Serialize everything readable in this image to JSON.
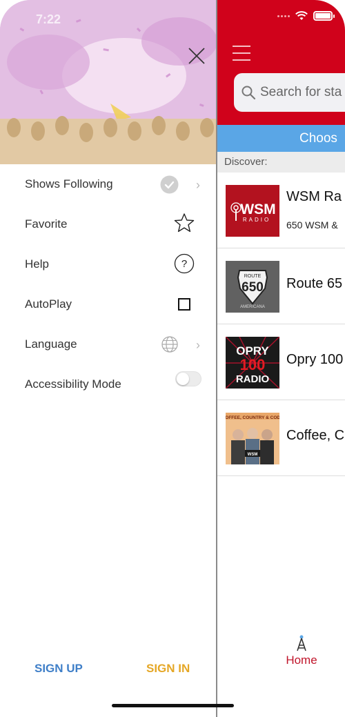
{
  "status_bar": {
    "time": "7:22"
  },
  "drawer": {
    "menu": [
      {
        "label": "Shows Following",
        "icon": "check-circle-icon",
        "has_chevron": true
      },
      {
        "label": "Favorite",
        "icon": "star-icon",
        "has_chevron": false
      },
      {
        "label": "Help",
        "icon": "question-circle-icon",
        "has_chevron": false
      },
      {
        "label": "AutoPlay",
        "icon": "checkbox-icon",
        "has_chevron": false,
        "checked": false
      },
      {
        "label": "Language",
        "icon": "globe-icon",
        "has_chevron": true
      },
      {
        "label": "Accessibility Mode",
        "icon": "toggle-switch",
        "has_chevron": false,
        "enabled": false
      }
    ],
    "chevron": "›",
    "signup_label": "SIGN UP",
    "signin_label": "SIGN IN"
  },
  "main": {
    "search_placeholder": "Search for sta",
    "choose_label": "Choos",
    "discover_label": "Discover:",
    "stations": [
      {
        "name": "WSM Ra",
        "subtitle": "650 WSM &",
        "logo": "wsm-radio-logo"
      },
      {
        "name": "Route 65",
        "subtitle": "",
        "logo": "route-650-logo"
      },
      {
        "name": "Opry 100",
        "subtitle": "",
        "logo": "opry-100-radio-logo"
      },
      {
        "name": "Coffee, C",
        "subtitle": "",
        "logo": "coffee-country-cody-logo"
      }
    ],
    "tab_home_label": "Home"
  },
  "colors": {
    "header_red": "#d0021b",
    "choose_blue": "#5aa6e6",
    "signup_blue": "#3f7fc8",
    "signin_gold": "#e5a726",
    "home_red": "#c0142a"
  }
}
